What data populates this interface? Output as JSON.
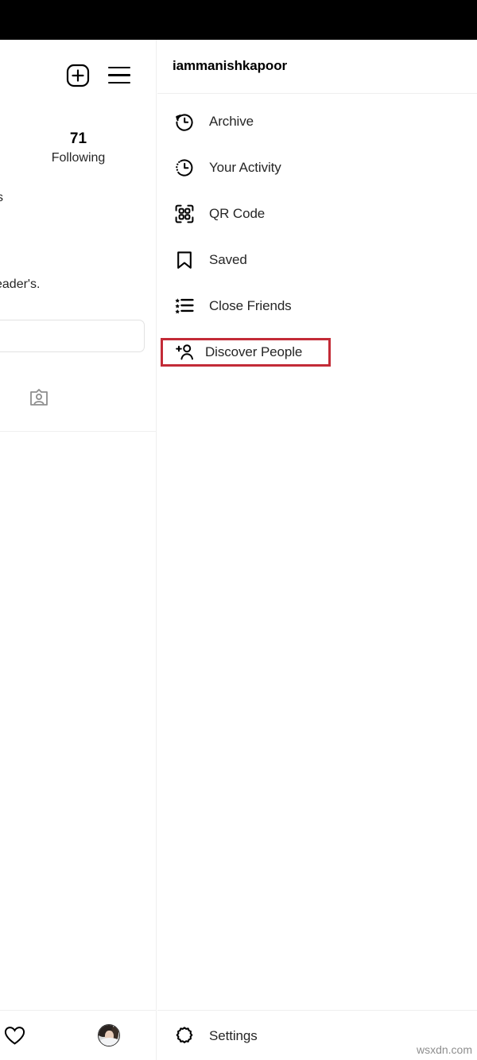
{
  "app": {
    "platform_bar_color": "#000000",
    "background": "#ffffff",
    "highlight_color": "#c32b37",
    "text_color": "#262626"
  },
  "profile_panel": {
    "actions": [
      {
        "name": "new-post",
        "icon": "plus-square-icon"
      },
      {
        "name": "menu",
        "icon": "hamburger-icon"
      }
    ],
    "stats": {
      "following_count": "71",
      "following_label": "Following",
      "followers_partial": "s"
    },
    "bio_partial": "eader's.",
    "edit_profile_value": "",
    "tabs": [
      {
        "name": "tagged",
        "icon": "tagged-person-icon"
      }
    ]
  },
  "menu": {
    "username": "iammanishkapoor",
    "items": [
      {
        "label": "Archive",
        "icon": "archive-clock-icon",
        "highlighted": false
      },
      {
        "label": "Your Activity",
        "icon": "activity-clock-icon",
        "highlighted": false
      },
      {
        "label": "QR Code",
        "icon": "qr-code-icon",
        "highlighted": false
      },
      {
        "label": "Saved",
        "icon": "bookmark-icon",
        "highlighted": false
      },
      {
        "label": "Close Friends",
        "icon": "close-friends-icon",
        "highlighted": false
      },
      {
        "label": "Discover People",
        "icon": "add-person-icon",
        "highlighted": true
      }
    ],
    "footer": {
      "label": "Settings",
      "icon": "gear-icon"
    }
  },
  "bottom_nav": {
    "items": [
      {
        "name": "activity",
        "icon": "heart-icon"
      },
      {
        "name": "profile",
        "icon": "avatar-icon"
      }
    ]
  },
  "watermark": "wsxdn.com"
}
